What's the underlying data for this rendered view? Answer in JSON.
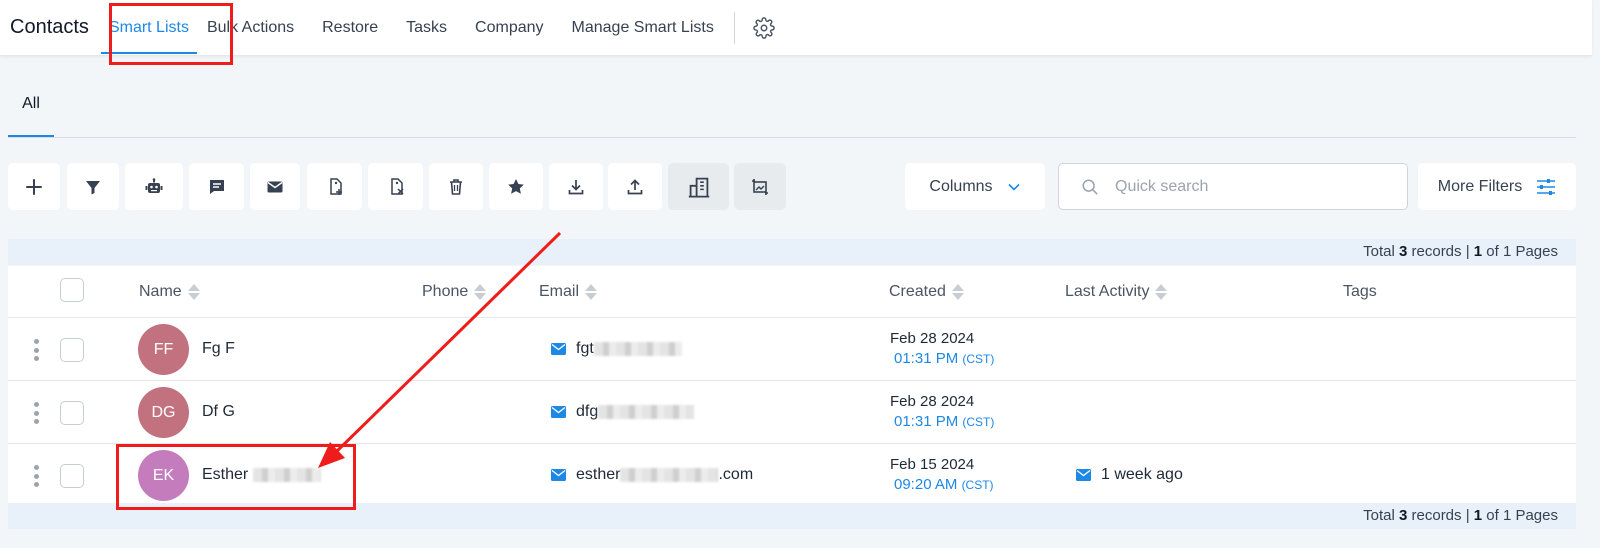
{
  "nav": {
    "brand": "Contacts",
    "items": [
      {
        "label": "Smart Lists",
        "active": true
      },
      {
        "label": "Bulk Actions"
      },
      {
        "label": "Restore"
      },
      {
        "label": "Tasks"
      },
      {
        "label": "Company"
      },
      {
        "label": "Manage Smart Lists"
      }
    ],
    "settings_icon": "gear-icon"
  },
  "subtabs": [
    {
      "label": "All",
      "active": true
    }
  ],
  "toolbar": {
    "icons": [
      "plus-icon",
      "filter-icon",
      "robot-icon",
      "message-icon",
      "mail-icon",
      "tag-add-icon",
      "tag-remove-icon",
      "trash-icon",
      "star-icon",
      "download-icon",
      "upload-icon",
      "building-icon",
      "image-crop-icon"
    ],
    "columns_label": "Columns",
    "search_placeholder": "Quick search",
    "more_filters_label": "More Filters"
  },
  "summary": {
    "prefix": "Total ",
    "total": "3",
    "middle": " records | ",
    "page": "1",
    "suffix": " of 1 Pages"
  },
  "table": {
    "columns": [
      "Name",
      "Phone",
      "Email",
      "Created",
      "Last Activity",
      "Tags"
    ],
    "rows": [
      {
        "initials": "FF",
        "avatar_color": "#c2727f",
        "name": "Fg F",
        "email_visible": "fgt",
        "email_end": "",
        "created_date": "Feb 28 2024",
        "created_time": "01:31 PM",
        "tz": "(CST)",
        "last_activity": ""
      },
      {
        "initials": "DG",
        "avatar_color": "#c2727f",
        "name": "Df G",
        "email_visible": "dfg",
        "email_end": "",
        "created_date": "Feb 28 2024",
        "created_time": "01:31 PM",
        "tz": "(CST)",
        "last_activity": ""
      },
      {
        "initials": "EK",
        "avatar_color": "#c47cbd",
        "name": "Esther",
        "email_visible": "esther",
        "email_end": ".com",
        "created_date": "Feb 15 2024",
        "created_time": "09:20 AM",
        "tz": "(CST)",
        "last_activity": "1 week ago"
      }
    ]
  },
  "colors": {
    "accent": "#1e88e5",
    "highlight": "#ef1c1c"
  }
}
